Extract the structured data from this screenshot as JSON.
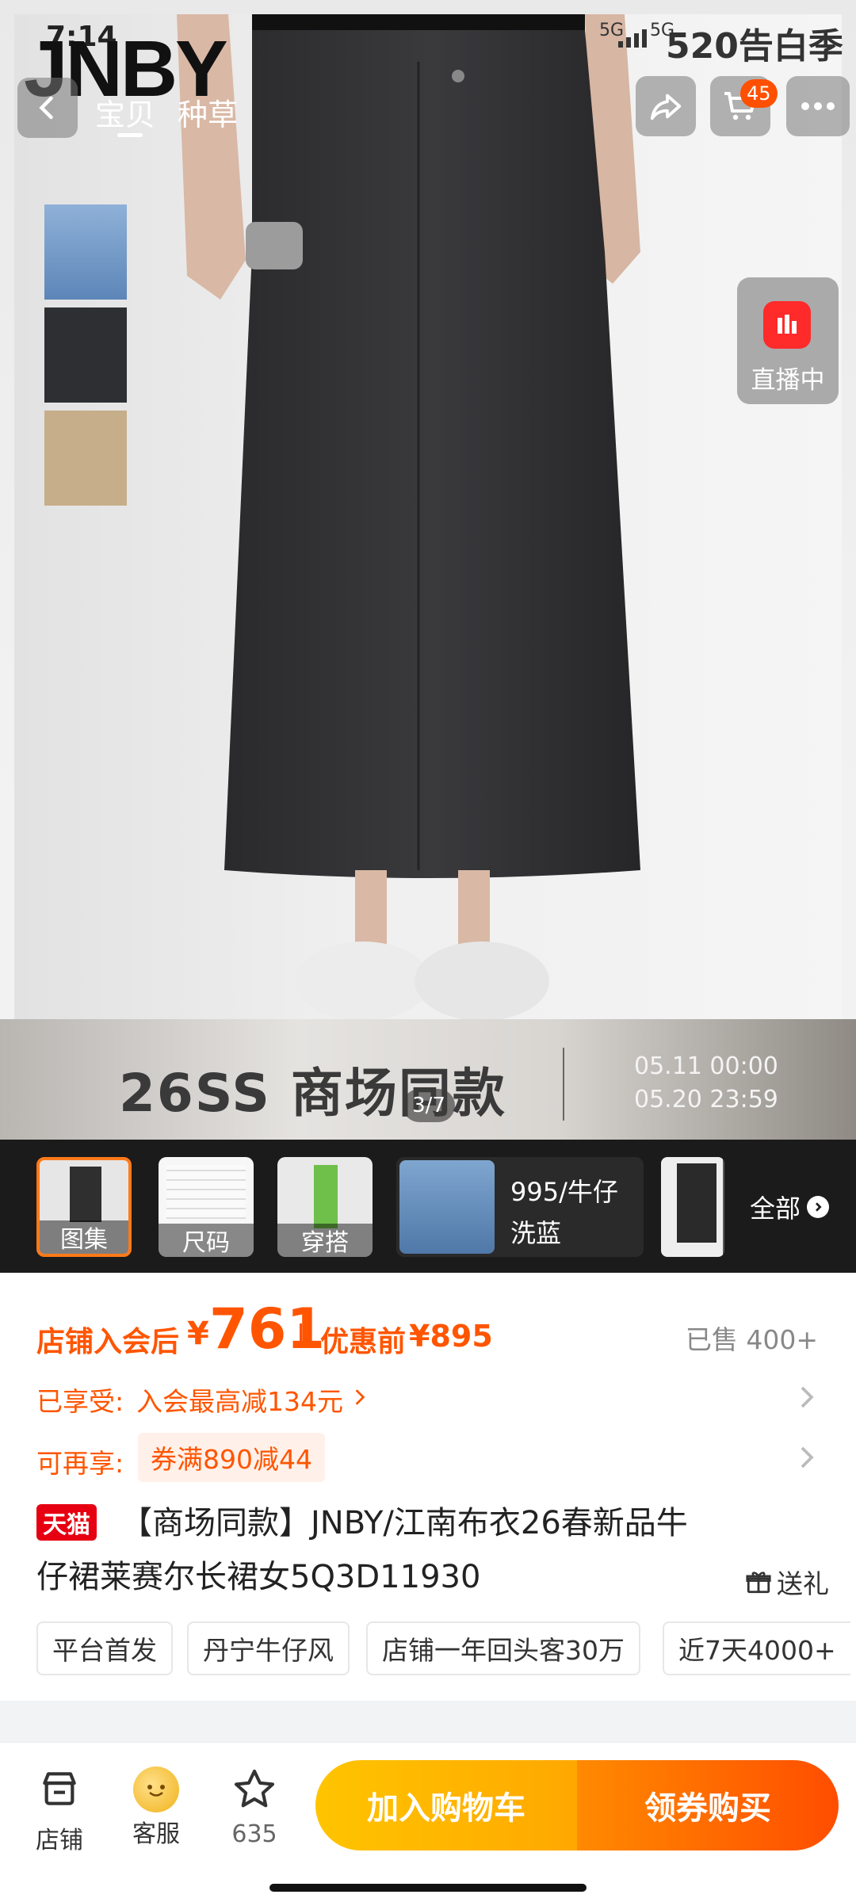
{
  "status_bar": {
    "time": "7:14",
    "network": "5G",
    "network2": "5G",
    "promo_logo": "520告白季"
  },
  "brand_logo": "JNBY",
  "top_tabs": [
    {
      "label": "宝贝"
    },
    {
      "label": "种草"
    }
  ],
  "cart_count": "45",
  "live": {
    "label": "直播中"
  },
  "banner": {
    "title": "26SS 商场同款",
    "date_start": "05.11 00:00",
    "date_end": "05.20 23:59",
    "page_indicator": "3/7"
  },
  "thumbnails": [
    {
      "label": "图集"
    },
    {
      "label": "尺码"
    },
    {
      "label": "穿搭"
    },
    {
      "label": "995/牛仔\n洗蓝"
    },
    {
      "label": "全部"
    }
  ],
  "price": {
    "member_prefix": "店铺入会后",
    "currency": "¥",
    "member_price": "761",
    "original_prefix": "优惠前",
    "original_price": "¥895",
    "sold": "已售 400+"
  },
  "promos": {
    "enjoyed_label": "已享受:",
    "enjoyed_value": "入会最高减134元",
    "more_label": "可再享:",
    "coupon": "券满890减44"
  },
  "product": {
    "platform_badge": "天猫",
    "title": "【商场同款】JNBY/江南布衣26春新品牛仔裙莱赛尔长裙女5Q3D11930",
    "gift_label": "送礼"
  },
  "tags": [
    "平台首发",
    "丹宁牛仔风",
    "店铺一年回头客30万",
    "近7天4000+"
  ],
  "bottom_bar": {
    "store_label": "店铺",
    "service_label": "客服",
    "favorite_count": "635",
    "add_to_cart": "加入购物车",
    "buy_with_coupon": "领券购买"
  },
  "colors": {
    "accent": "#ff5000",
    "price_orange": "#ff5500",
    "cart_button": "#ffb400",
    "buy_button": "#ff5000",
    "tmall_red": "#e60012"
  }
}
